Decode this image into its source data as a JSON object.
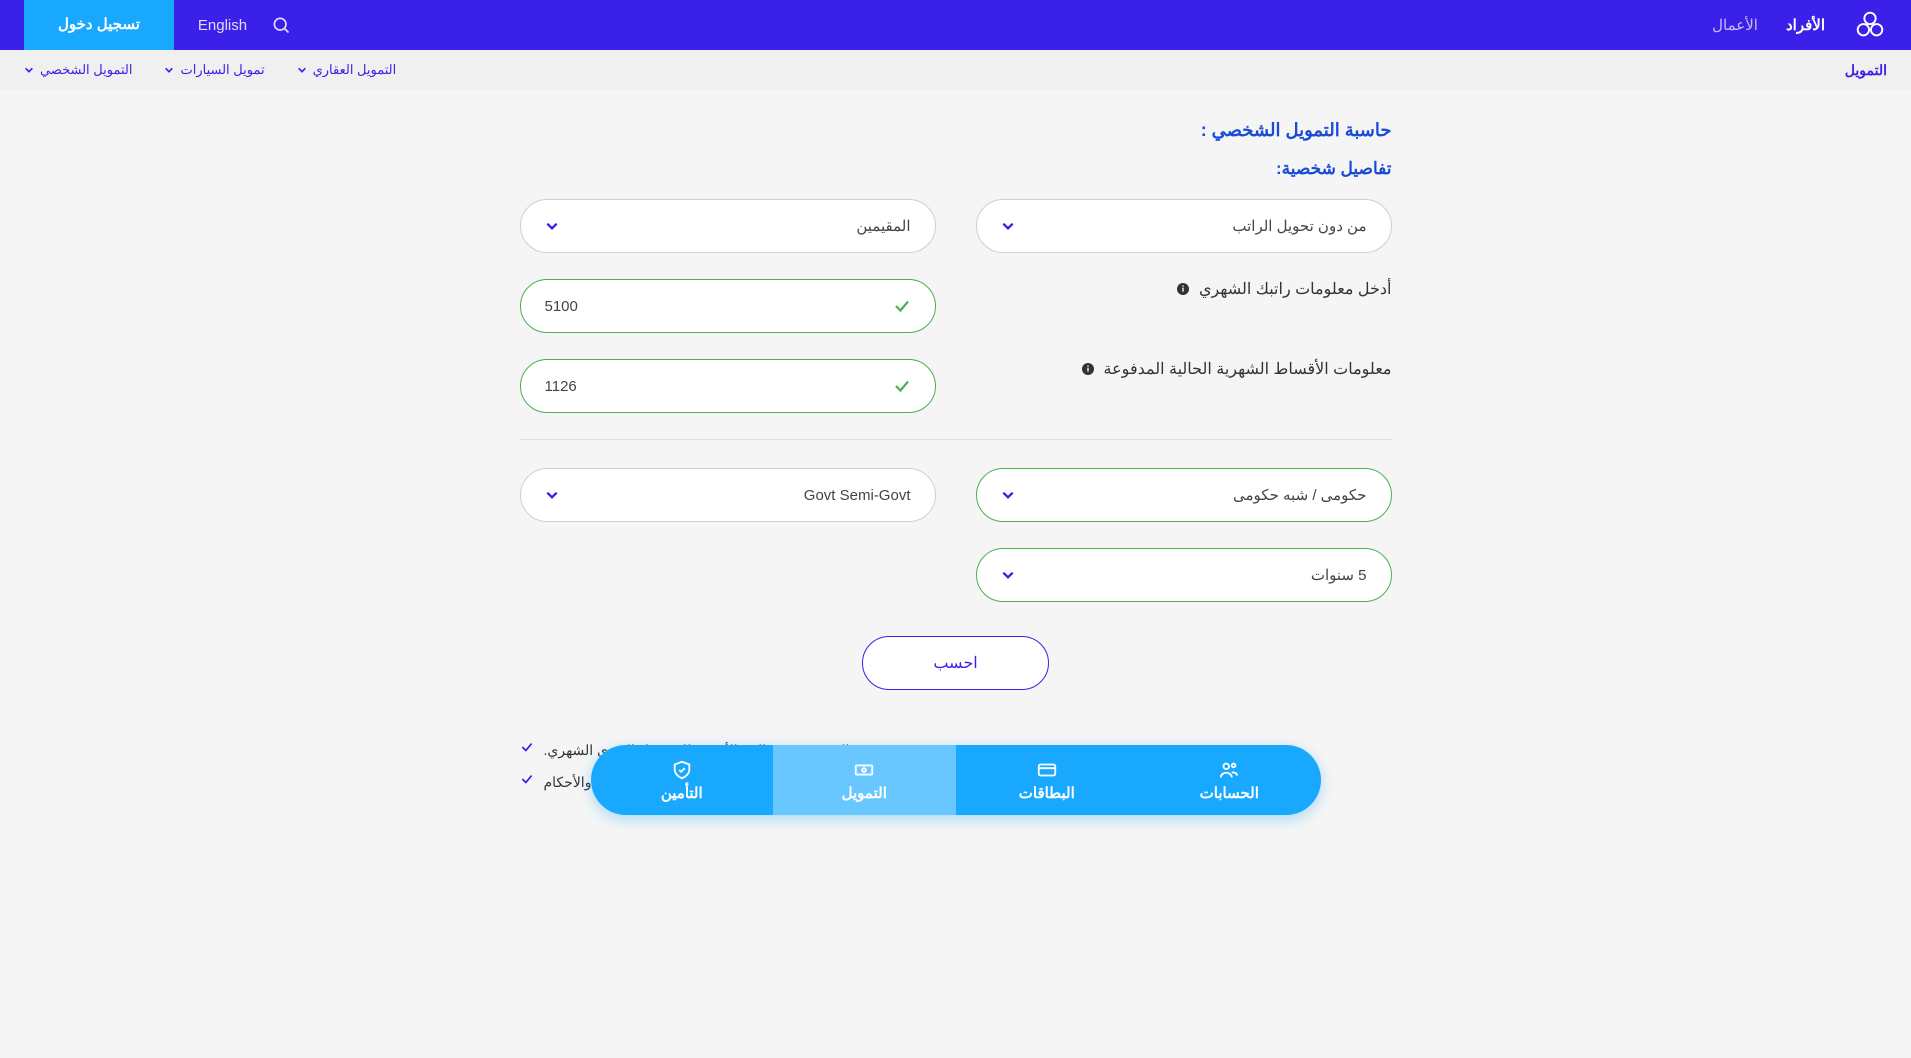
{
  "topbar": {
    "individualsLabel": "الأفراد",
    "businessLabel": "الأعمال",
    "languageLabel": "English",
    "loginLabel": "تسجيل دخول"
  },
  "secondbar": {
    "title": "التمويل",
    "links": [
      "التمويل العقاري",
      "تمويل السيارات",
      "التمويل الشخصي"
    ]
  },
  "calculator": {
    "title": "حاسبة التمويل الشخصي :",
    "subtitle": "تفاصيل شخصية:",
    "salaryTransferSelected": "من دون تحويل الراتب",
    "residencySelected": "المقيمين",
    "monthlySalaryLabel": "أدخل معلومات راتبك الشهري",
    "monthlySalaryValue": "5100",
    "installmentsLabel": "معلومات الأقساط الشهرية الحالية المدفوعة",
    "installmentsValue": "1126",
    "sectorArSelected": "حكومى / شبه حكومى",
    "sectorEnSelected": "Govt Semi-Govt",
    "tenureSelected": "5 سنوات",
    "calcButton": "احسب"
  },
  "notes": [
    "500 ريال سعودي هو الحد الأقصى للاسترداد النقدي الشهري.",
    "الاسترداد النقدي مؤهل على المعاملات التي تتم على فئات الاسترداد النقدي المؤهلة، حسب الشروط والأحكام"
  ],
  "bottomNav": {
    "accountsLabel": "الحسابات",
    "cardsLabel": "البطاقات",
    "financingLabel": "التمويل",
    "insuranceLabel": "التأمين"
  }
}
